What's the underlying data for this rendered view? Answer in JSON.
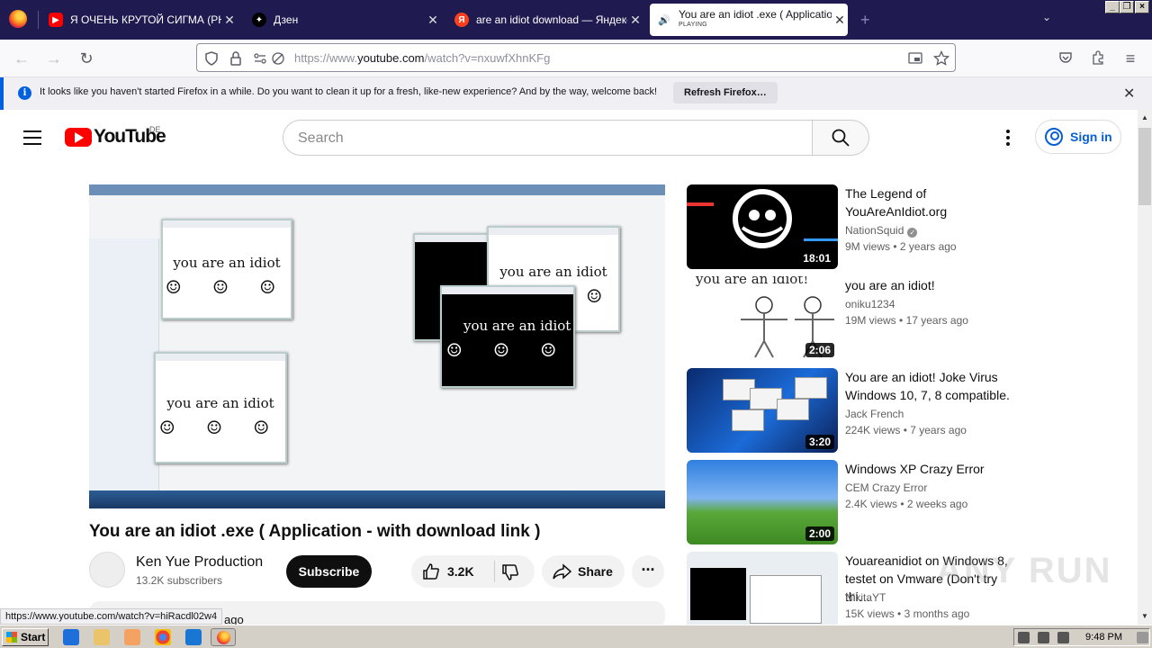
{
  "browser": {
    "tabs": [
      {
        "title": "Я ОЧЕНЬ КРУТОЙ СИГМА (PHONK",
        "icon": "youtube-icon",
        "active": false
      },
      {
        "title": "Дзен",
        "icon": "dzen-icon",
        "active": false
      },
      {
        "title": "are an idiot download — Яндекс: на",
        "icon": "yandex-icon",
        "active": false
      },
      {
        "title": "You are an idiot .exe ( Application",
        "status": "PLAYING",
        "icon": "speaker-icon",
        "active": true
      }
    ],
    "url": "https://www.youtube.com/watch?v=nxuwfXhnKFg",
    "url_domain": "youtube.com"
  },
  "notification": {
    "message": "It looks like you haven't started Firefox in a while. Do you want to clean it up for a fresh, like-new experience? And by the way, welcome back!",
    "button": "Refresh Firefox…"
  },
  "youtube": {
    "logo_text": "YouTube",
    "country": "DE",
    "search_placeholder": "Search",
    "signin": "Sign in"
  },
  "video": {
    "title": "You are an idiot .exe ( Application - with download link )",
    "channel": "Ken Yue Production",
    "subscribers": "13.2K subscribers",
    "subscribe": "Subscribe",
    "likes": "3.2K",
    "share": "Share",
    "description_preview": "ago",
    "embedded_popup_text": "you are an idiot",
    "embedded_faces": "☺ ☺ ☺"
  },
  "status_url": "https://www.youtube.com/watch?v=hiRacdl02w4",
  "recommendations": [
    {
      "title": "The Legend of YouAreAnIdiot.org",
      "channel": "NationSquid",
      "verified": true,
      "views": "9M views",
      "age": "2 years ago",
      "duration": "18:01"
    },
    {
      "title": "you are an idiot!",
      "channel": "oniku1234",
      "verified": false,
      "views": "19M views",
      "age": "17 years ago",
      "duration": "2:06",
      "thumb_text": "you are an idiot!"
    },
    {
      "title": "You are an idiot! Joke Virus Windows 10, 7, 8 compatible.",
      "channel": "Jack French",
      "verified": false,
      "views": "224K views",
      "age": "7 years ago",
      "duration": "3:20"
    },
    {
      "title": "Windows XP Crazy Error",
      "channel": "CEM Crazy Error",
      "verified": false,
      "views": "2.4K views",
      "age": "2 weeks ago",
      "duration": "2:00"
    },
    {
      "title": "Youareanidiot on Windows 8, testet on Vmware (Don't try thi…",
      "channel": "NikitaYT",
      "verified": false,
      "views": "15K views",
      "age": "3 months ago",
      "duration": ""
    }
  ],
  "taskbar": {
    "start": "Start",
    "clock": "9:48 PM"
  },
  "watermark": "ANY RUN"
}
